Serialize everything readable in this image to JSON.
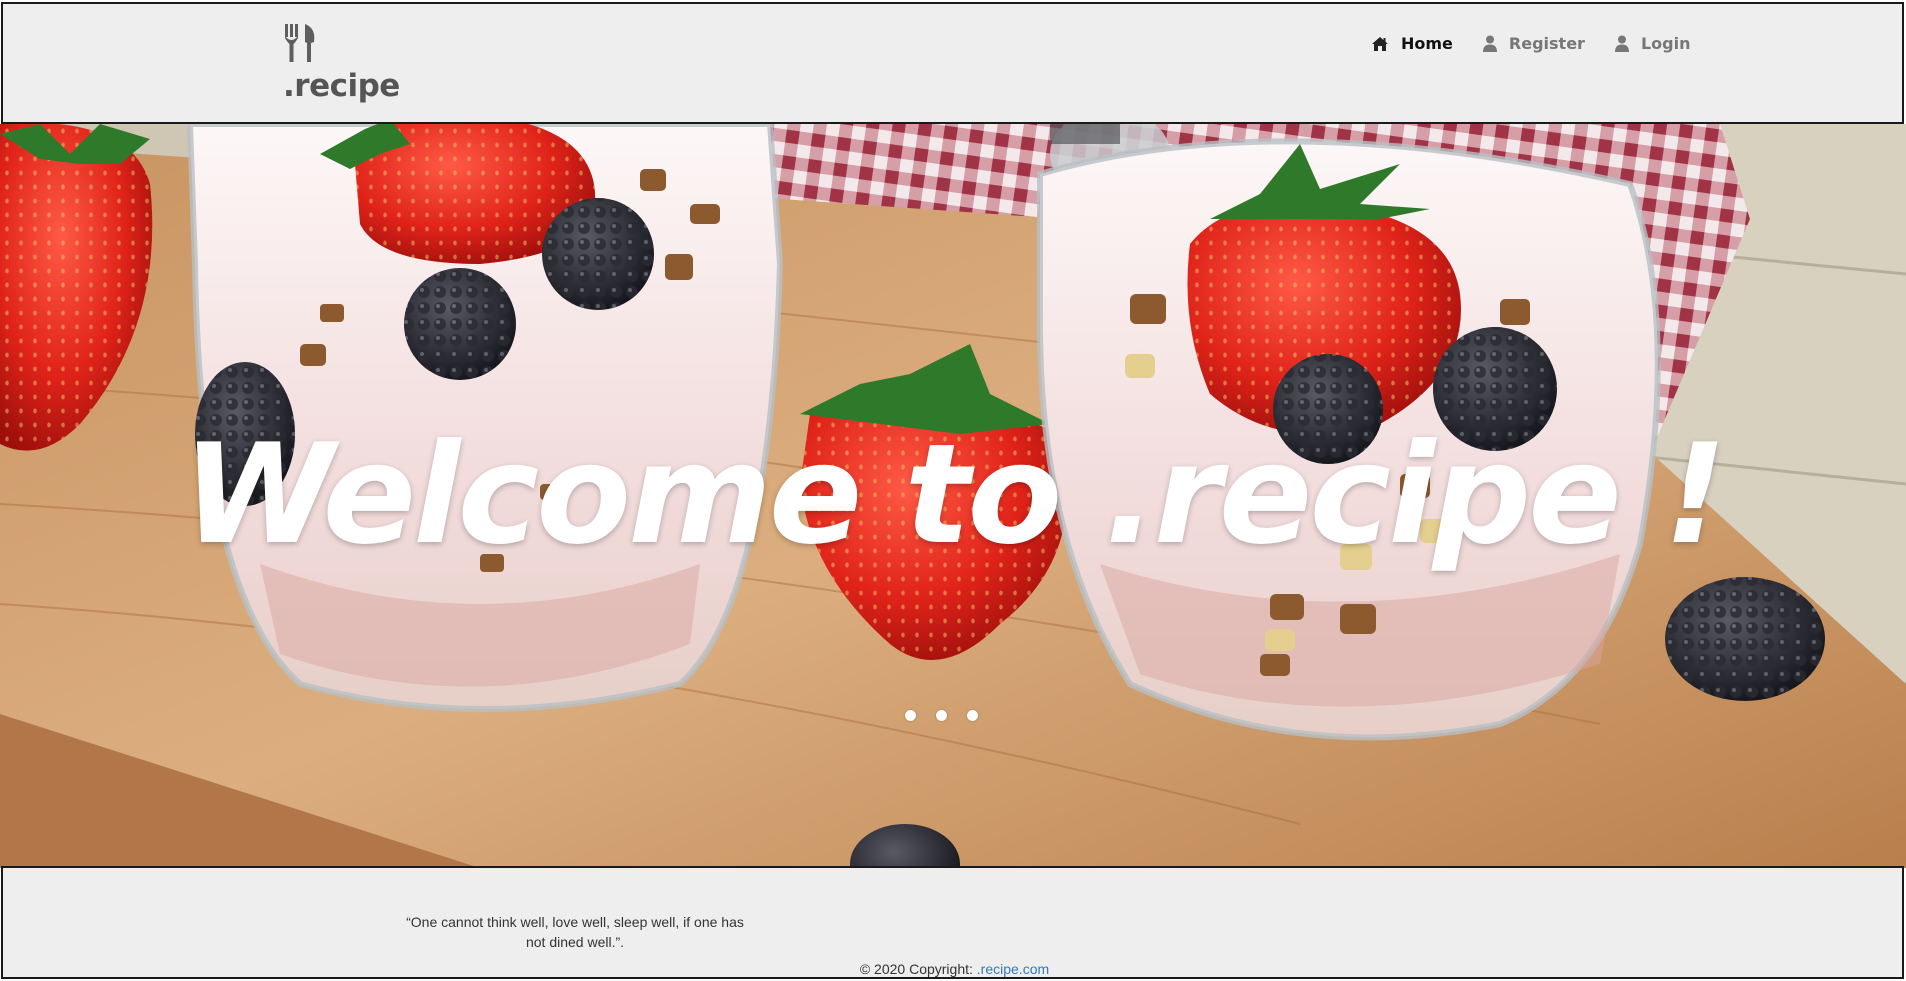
{
  "brand": {
    "name": ".recipe",
    "icon": "fork-knife-icon"
  },
  "nav": {
    "items": [
      {
        "label": "Home",
        "icon": "home-icon",
        "active": true
      },
      {
        "label": "Register",
        "icon": "user-icon",
        "active": false
      },
      {
        "label": "Login",
        "icon": "user-icon",
        "active": false
      }
    ]
  },
  "hero": {
    "title": "Welcome to .recipe !",
    "carousel_slides": 3
  },
  "footer": {
    "quote": "“One cannot think well, love well, sleep well, if one has not dined well.”.",
    "copyright_prefix": "© 2020 Copyright: ",
    "copyright_link": ".recipe.com"
  },
  "colors": {
    "header_bg": "#eeeeee",
    "nav_active": "#111111",
    "nav_inactive": "#777777",
    "link": "#337ab7"
  }
}
